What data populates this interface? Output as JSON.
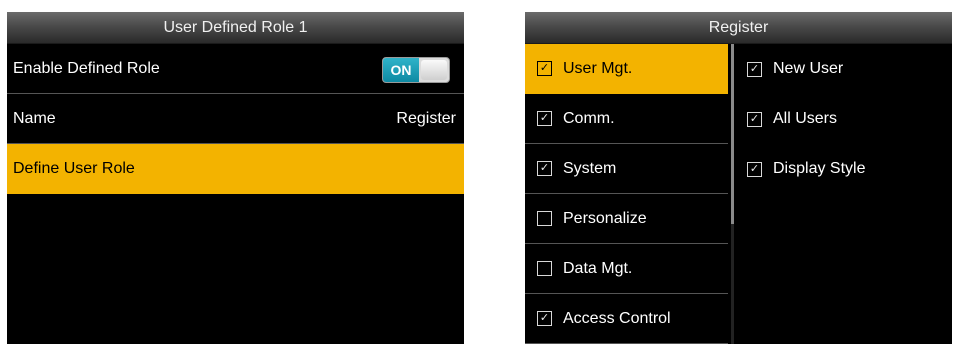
{
  "left_screen": {
    "title": "User Defined Role 1",
    "rows": {
      "enable_role": {
        "label": "Enable Defined Role",
        "toggle_text": "ON"
      },
      "name": {
        "label": "Name",
        "value": "Register"
      },
      "define_role": {
        "label": "Define User Role"
      }
    }
  },
  "right_screen": {
    "title": "Register",
    "categories": [
      {
        "label": "User Mgt.",
        "checked": true,
        "selected": true
      },
      {
        "label": "Comm.",
        "checked": true,
        "selected": false
      },
      {
        "label": "System",
        "checked": true,
        "selected": false
      },
      {
        "label": "Personalize",
        "checked": false,
        "selected": false
      },
      {
        "label": "Data Mgt.",
        "checked": false,
        "selected": false
      },
      {
        "label": "Access Control",
        "checked": true,
        "selected": false
      }
    ],
    "subitems": [
      {
        "label": "New User",
        "checked": true
      },
      {
        "label": "All Users",
        "checked": true
      },
      {
        "label": "Display Style",
        "checked": true
      }
    ]
  },
  "colors": {
    "highlight": "#f3b300",
    "toggle_on": "#0e8aa3",
    "background": "#000000"
  }
}
